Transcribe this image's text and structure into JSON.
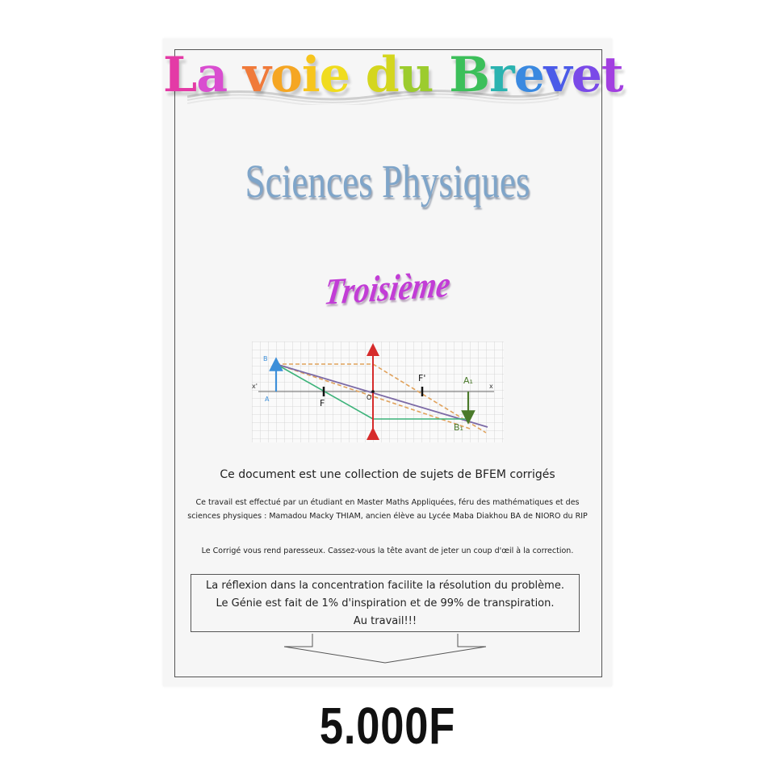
{
  "cover": {
    "title_letters": [
      "L",
      "a",
      " ",
      "v",
      "o",
      "i",
      "e",
      " ",
      "d",
      "u",
      " ",
      "B",
      "r",
      "e",
      "v",
      "e",
      "t"
    ],
    "title_colors": [
      "#e43aa6",
      "#d94dd0",
      "#ffffff",
      "#f07a3a",
      "#f5a623",
      "#f7c51d",
      "#f0dc1e",
      "#ffffff",
      "#d4d61e",
      "#9ccc2e",
      "#ffffff",
      "#3cbf5a",
      "#2bb3b0",
      "#3a89e0",
      "#4b5be8",
      "#7a4ae8",
      "#a23fe0"
    ],
    "subject": "Sciences Physiques",
    "level": "Troisième",
    "collection": "Ce document est une collection de sujets de BFEM corrigés",
    "author_text": "Ce travail est effectué par un étudiant en Master Maths Appliquées, féru des mathématiques et des sciences physiques : Mamadou Macky THIAM, ancien élève au Lycée Maba Diakhou BA de NIORO du RIP",
    "advice": "Le Corrigé vous rend paresseux. Cassez-vous la tête avant de jeter un coup d'œil à la correction.",
    "quote": {
      "line1": "La réflexion dans la concentration facilite la résolution du problème.",
      "line2": "Le Génie est fait de 1% d'inspiration et de 99% de transpiration.",
      "line3": "Au travail!!!"
    }
  },
  "diagram": {
    "labels": {
      "B": "B",
      "x_prime": "x'",
      "A": "A",
      "F": "F",
      "O": "O",
      "F_prime": "F'",
      "A1": "A₁",
      "x": "x",
      "B1": "B₁"
    },
    "colors": {
      "object": "#3d8fd9",
      "lens": "#d62b2b",
      "ray_orange": "#e0a15a",
      "ray_purple": "#7c6aa6",
      "ray_green": "#3db37a",
      "image": "#4a7a2a"
    }
  },
  "price": "5.000F"
}
